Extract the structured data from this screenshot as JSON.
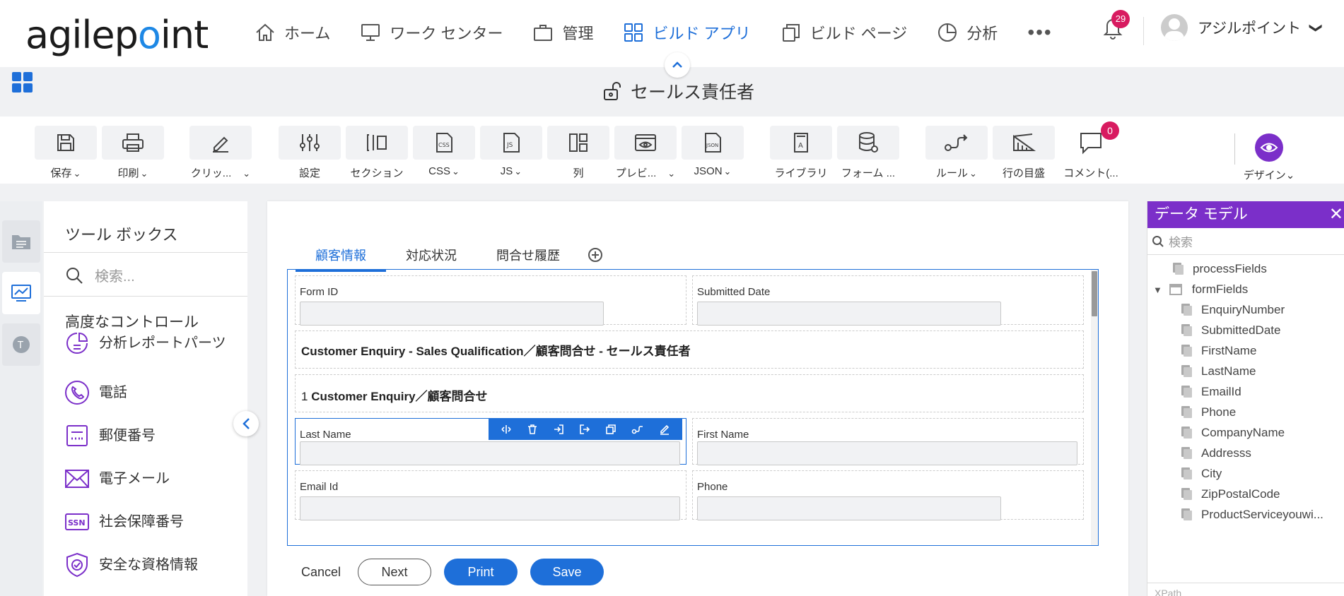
{
  "logo": {
    "before": "agilep",
    "dot": "o",
    "after": "int"
  },
  "nav": [
    {
      "label": "ホーム",
      "icon": "home-icon"
    },
    {
      "label": "ワーク センター",
      "icon": "monitor-icon"
    },
    {
      "label": "管理",
      "icon": "briefcase-icon"
    },
    {
      "label": "ビルド アプリ",
      "icon": "apps-grid-icon",
      "active": true
    },
    {
      "label": "ビルド ページ",
      "icon": "pages-icon"
    },
    {
      "label": "分析",
      "icon": "pie-chart-icon"
    }
  ],
  "nav_more": "•••",
  "notifications": {
    "count": "29"
  },
  "user": {
    "name": "アジルポイント",
    "chevron": "❯"
  },
  "app": {
    "title": "セールス責任者"
  },
  "toolbar": {
    "save": "保存",
    "print": "印刷",
    "clipboard": "クリッ...",
    "settings": "設定",
    "section": "セクション",
    "css": "CSS",
    "js": "JS",
    "columns": "列",
    "preview": "プレビ...",
    "json": "JSON",
    "library": "ライブラリ",
    "form": "フォーム ...",
    "rules": "ルール",
    "ruler": "行の目盛",
    "comments": "コメント(...",
    "comment_count": "0",
    "design": "デザイン",
    "chev": "⌄"
  },
  "toolbox": {
    "title": "ツール ボックス",
    "search_placeholder": "検索...",
    "category": "高度なコントロール",
    "items": [
      {
        "label": "分析レポートパーツ",
        "icon": "report-parts-icon"
      },
      {
        "label": "電話",
        "icon": "phone-icon"
      },
      {
        "label": "郵便番号",
        "icon": "postal-code-icon"
      },
      {
        "label": "電子メール",
        "icon": "email-icon"
      },
      {
        "label": "社会保障番号",
        "icon": "ssn-icon"
      },
      {
        "label": "安全な資格情報",
        "icon": "secure-credential-icon"
      }
    ],
    "ssn_text": "SSN"
  },
  "tabs": [
    "顧客情報",
    "対応状況",
    "問合せ履歴"
  ],
  "form": {
    "form_id": "Form ID",
    "submitted_date": "Submitted Date",
    "heading1": "Customer Enquiry - Sales Qualification／顧客問合せ - セールス責任者",
    "heading2_num": "1",
    "heading2": "Customer Enquiry／顧客問合せ",
    "last_name": "Last Name",
    "first_name": "First Name",
    "email_id": "Email Id",
    "phone": "Phone"
  },
  "buttons": {
    "cancel": "Cancel",
    "next": "Next",
    "print": "Print",
    "save": "Save"
  },
  "datamodel": {
    "title": "データ モデル",
    "close": "✕",
    "search_placeholder": "検索",
    "process_fields": "processFields",
    "form_fields": "formFields",
    "fields": [
      "EnquiryNumber",
      "SubmittedDate",
      "FirstName",
      "LastName",
      "EmailId",
      "Phone",
      "CompanyName",
      "Addresss",
      "City",
      "ZipPostalCode",
      "ProductServiceyouwi..."
    ],
    "footer": "XPath"
  },
  "colors": {
    "accent": "#1e6fd9",
    "purple": "#7b2fc9",
    "badge": "#d81b60"
  }
}
